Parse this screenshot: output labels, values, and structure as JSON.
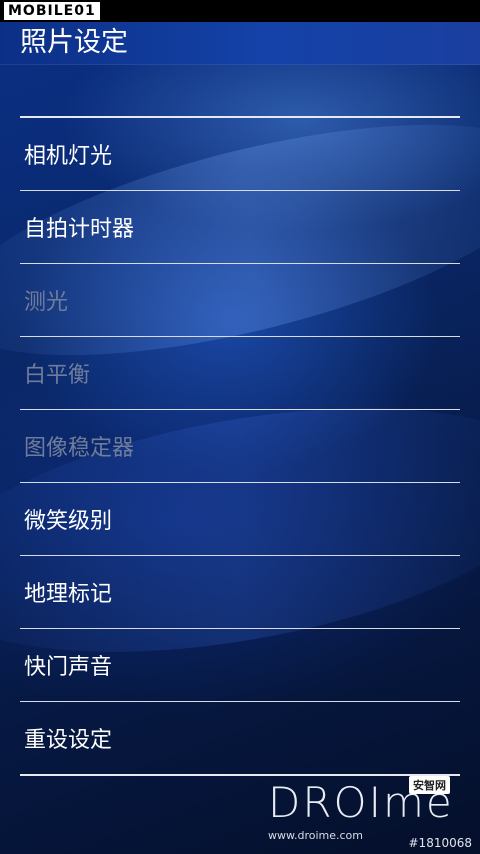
{
  "status_bar": {
    "brand": "MOBILE01"
  },
  "header": {
    "title": "照片设定"
  },
  "menu": {
    "items": [
      {
        "label": "相机灯光",
        "enabled": true
      },
      {
        "label": "自拍计时器",
        "enabled": true
      },
      {
        "label": "测光",
        "enabled": false
      },
      {
        "label": "白平衡",
        "enabled": false
      },
      {
        "label": "图像稳定器",
        "enabled": false
      },
      {
        "label": "微笑级别",
        "enabled": true
      },
      {
        "label": "地理标记",
        "enabled": true
      },
      {
        "label": "快门声音",
        "enabled": true
      },
      {
        "label": "重设设定",
        "enabled": true
      }
    ]
  },
  "watermark": {
    "logo": "DROIme",
    "badge": "安智网",
    "url": "www.droime.com",
    "image_id": "#1810068"
  },
  "colors": {
    "enabled_text": "#ffffff",
    "disabled_text": "#6f7d9a",
    "title_bar": "#1442a8",
    "background": "#04122e"
  }
}
